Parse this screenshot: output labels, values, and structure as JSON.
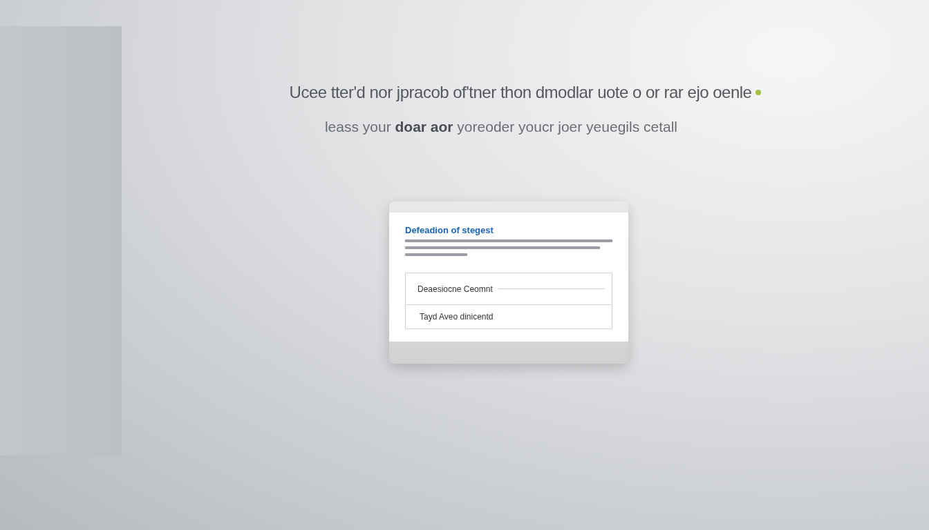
{
  "headline": "Ucee tter'd nor jpracob of'tner thon dmodlar uote o or rar ejo oenle",
  "subline": "leass your **doar aor** yoreoder youcr joer yeuegils cetall",
  "dialog": {
    "title": "Defeadion of stegest",
    "rows": [
      {
        "kind": "field",
        "label": "Deaesiocne Ceomnt"
      },
      {
        "kind": "option",
        "label": "Tayd Aveo dinicentd"
      }
    ]
  }
}
